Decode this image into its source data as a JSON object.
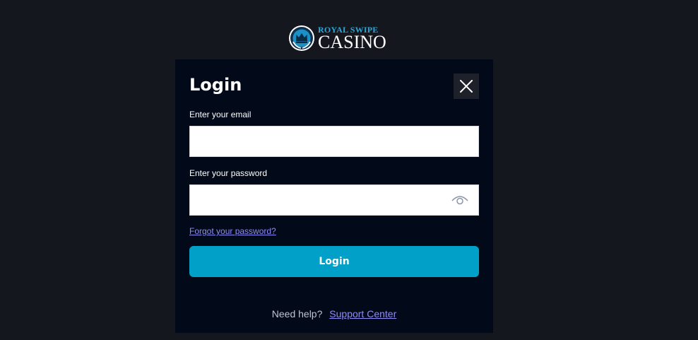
{
  "brand": {
    "line1": "ROYAL SWIPE",
    "line2": "CASINO"
  },
  "modal": {
    "title": "Login",
    "close_icon": "close-icon"
  },
  "form": {
    "email_label": "Enter your email",
    "email_value": "",
    "email_placeholder": "",
    "password_label": "Enter your password",
    "password_value": "",
    "password_placeholder": "",
    "show_password_icon": "eye-icon",
    "forgot_link": "Forgot your password?",
    "submit_label": "Login"
  },
  "help": {
    "prompt": "Need help?",
    "link": "Support Center"
  },
  "colors": {
    "page_bg": "#15171f",
    "modal_bg": "#020a1a",
    "accent": "#01a0c8",
    "link": "#8c8cf2",
    "brand_blue": "#2aa7d8"
  }
}
